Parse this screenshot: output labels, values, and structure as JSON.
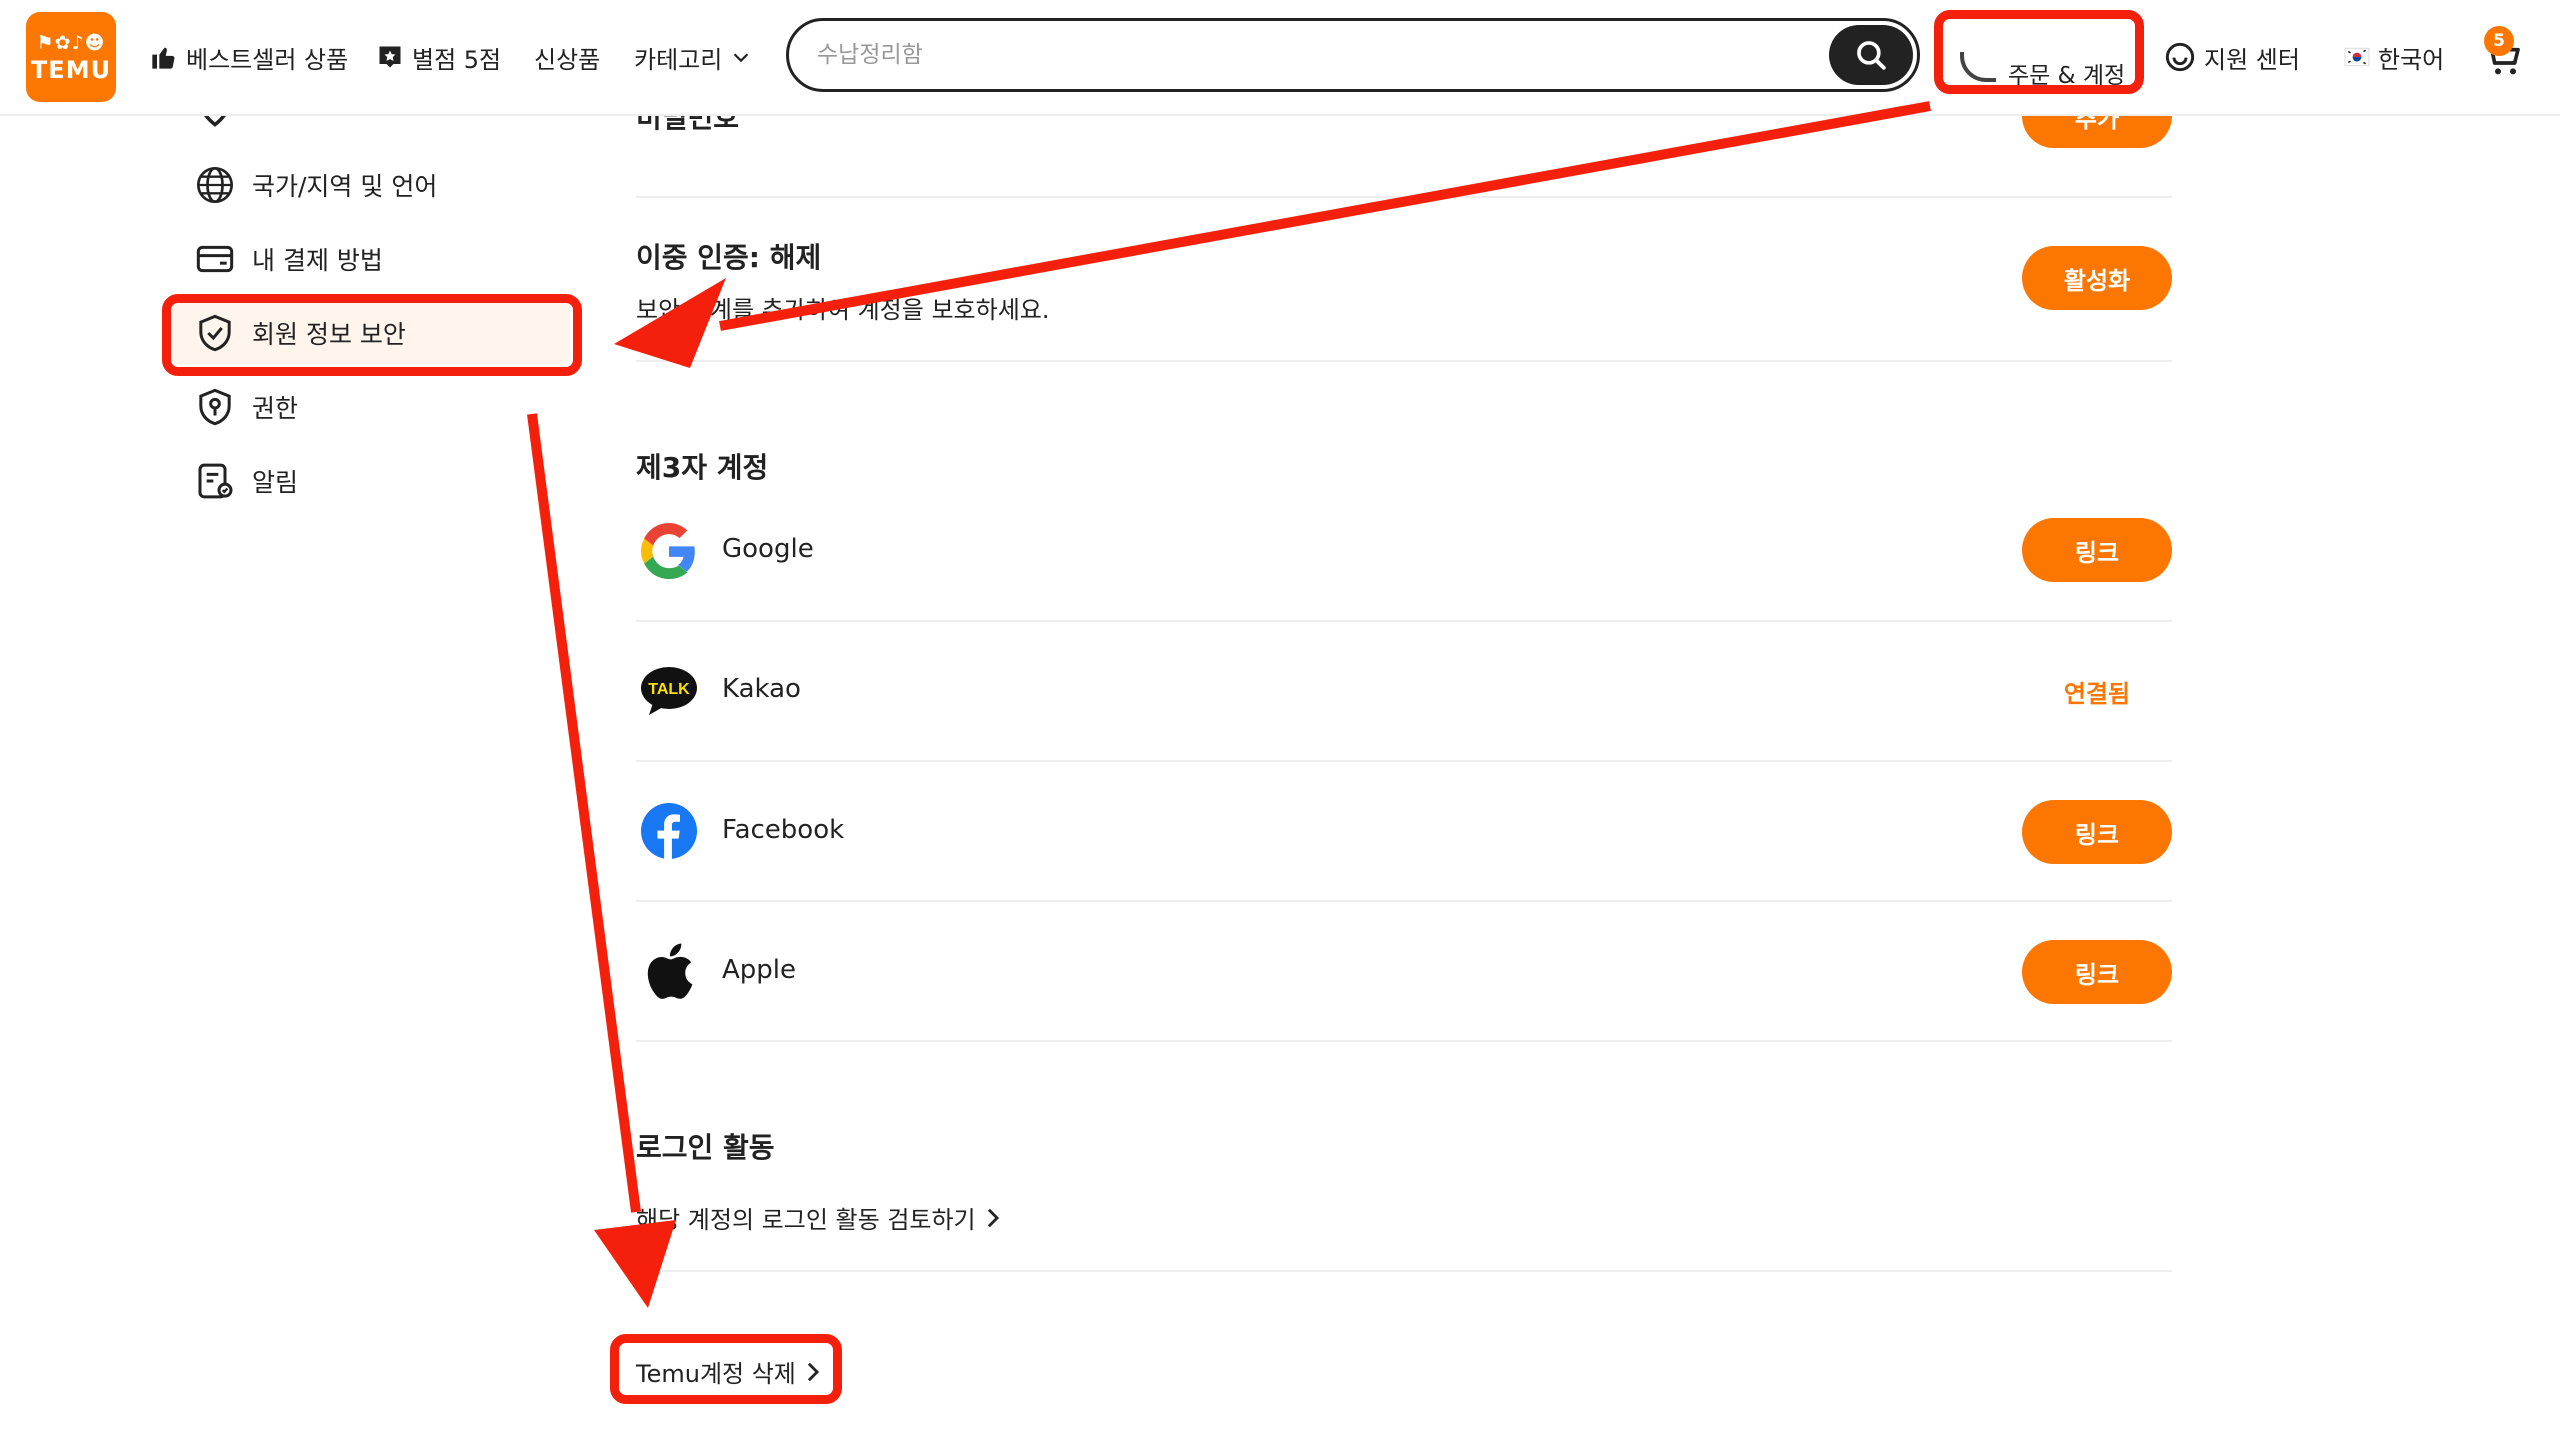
{
  "brand": {
    "logo_text": "TEMU",
    "accent_color": "#fb7701",
    "annotation_color": "#f4200c"
  },
  "header": {
    "nav": [
      {
        "label": "베스트셀러 상품",
        "icon": "thumbs-up-icon"
      },
      {
        "label": "별점 5점",
        "icon": "star-badge-icon"
      },
      {
        "label": "신상품"
      },
      {
        "label": "카테고리",
        "icon": "chevron-down-icon"
      }
    ],
    "search_placeholder": "수납정리함",
    "account_label": "주문 & 계정",
    "support_label": "지원 센터",
    "language_label": "한국어",
    "cart_count": "5"
  },
  "sidebar": {
    "items": [
      {
        "label": "국가/지역 및 언어",
        "icon": "globe-icon"
      },
      {
        "label": "내 결제 방법",
        "icon": "wallet-icon"
      },
      {
        "label": "회원 정보 보안",
        "icon": "shield-check-icon",
        "active": true
      },
      {
        "label": "권한",
        "icon": "permission-shield-icon"
      },
      {
        "label": "알림",
        "icon": "notification-icon"
      }
    ]
  },
  "content": {
    "password_partial": "비밀번호",
    "add_button": "추가",
    "two_factor": {
      "title": "이중 인증: 해제",
      "description": "보안 단계를 추가하여 계정을 보호하세요.",
      "button": "활성화"
    },
    "third_party": {
      "title": "제3자 계정",
      "accounts": [
        {
          "name": "Google",
          "icon": "google-icon",
          "action": "링크"
        },
        {
          "name": "Kakao",
          "icon": "kakao-talk-icon",
          "action": "연결됨"
        },
        {
          "name": "Facebook",
          "icon": "facebook-icon",
          "action": "링크"
        },
        {
          "name": "Apple",
          "icon": "apple-icon",
          "action": "링크"
        }
      ]
    },
    "login_activity": {
      "title": "로그인 활동",
      "link": "해당 계정의 로그인 활동 검토하기"
    },
    "delete_account": "Temu계정 삭제"
  }
}
